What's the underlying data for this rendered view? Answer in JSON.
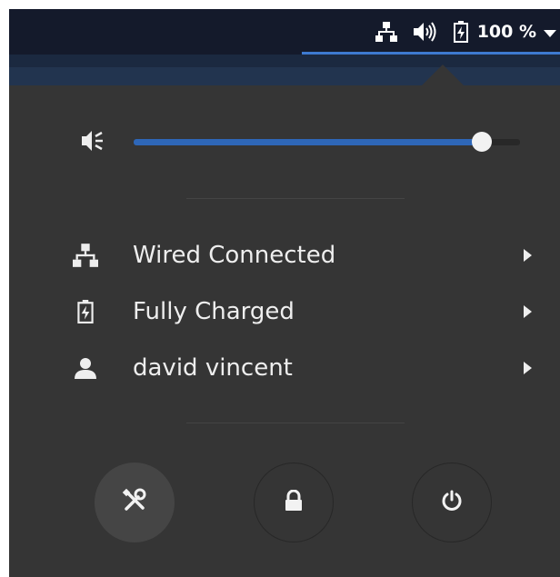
{
  "topbar": {
    "icons": [
      "network-wired-icon",
      "speaker-icon",
      "battery-charging-icon",
      "dropdown-caret-icon"
    ],
    "battery_percent": "100 %"
  },
  "menu": {
    "volume": {
      "icon": "speaker-muted-icon",
      "level": 0.9
    },
    "items": [
      {
        "icon": "network-wired-icon",
        "label": "Wired Connected"
      },
      {
        "icon": "battery-charging-icon",
        "label": "Fully Charged"
      },
      {
        "icon": "user-icon",
        "label": "david vincent"
      }
    ],
    "actions": [
      {
        "icon": "settings-tools-icon",
        "name": "settings"
      },
      {
        "icon": "lock-icon",
        "name": "lock"
      },
      {
        "icon": "power-icon",
        "name": "power-off"
      }
    ]
  },
  "colors": {
    "panel_bg": "#141a2b",
    "menu_bg": "#353535",
    "accent": "#2e67b8",
    "text": "#eeeeee"
  }
}
